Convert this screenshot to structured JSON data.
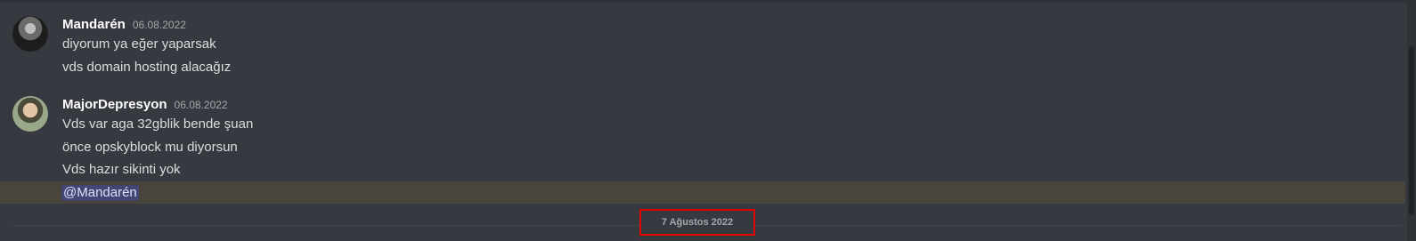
{
  "messages": [
    {
      "author": "Mandarén",
      "timestamp": "06.08.2022",
      "lines": [
        "diyorum ya eğer yaparsak",
        "vds domain hosting alacağız"
      ]
    },
    {
      "author": "MajorDepresyon",
      "timestamp": "06.08.2022",
      "lines": [
        "Vds var aga 32gblik bende şuan",
        "önce opskyblock mu diyorsun",
        "Vds hazır sikinti yok"
      ],
      "mention": "@Mandarén"
    }
  ],
  "date_divider": "7 Ağustos 2022",
  "colors": {
    "background": "#36393f",
    "username": "#ffffff",
    "mention_highlight": "#49443c",
    "mention_pill": "#414675",
    "annotation_box": "#e00000"
  }
}
